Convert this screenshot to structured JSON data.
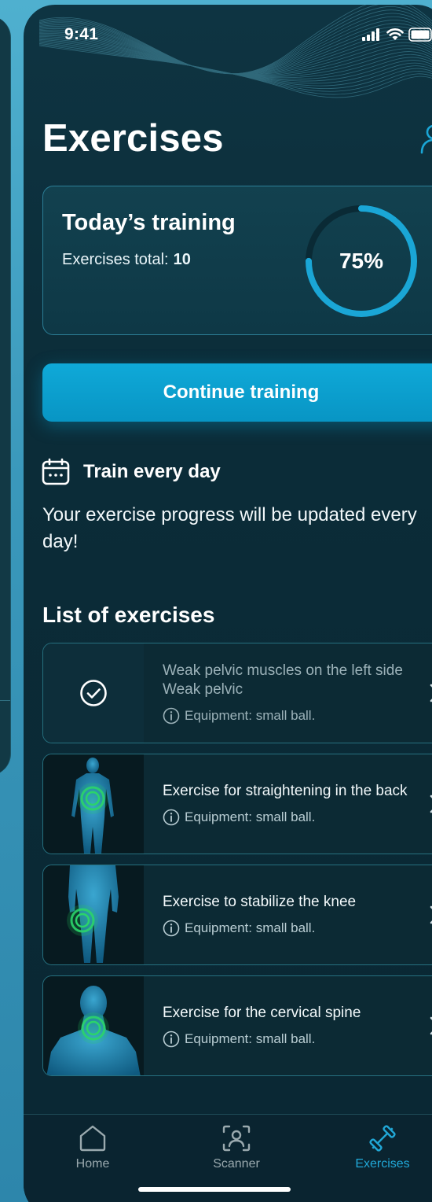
{
  "status_bar": {
    "time": "9:41"
  },
  "page": {
    "title": "Exercises"
  },
  "today": {
    "title": "Today’s training",
    "total_label": "Exercises total:",
    "total_value": "10",
    "progress_label": "75%",
    "progress": 0.75
  },
  "cta": {
    "label": "Continue training"
  },
  "reminder": {
    "title": "Train every day",
    "text": "Your exercise progress will be updated every day!"
  },
  "list": {
    "title": "List of exercises",
    "items": [
      {
        "name": "Weak pelvic muscles on the left side Weak pelvic",
        "equipment": "Equipment: small ball.",
        "status": "completed"
      },
      {
        "name": "Exercise for straightening in the back",
        "equipment": "Equipment: small ball.",
        "status": "pending"
      },
      {
        "name": "Exercise to stabilize the knee",
        "equipment": "Equipment: small ball.",
        "status": "pending"
      },
      {
        "name": "Exercise for the cervical spine",
        "equipment": "Equipment: small ball.",
        "status": "pending"
      }
    ]
  },
  "tabbar": {
    "items": [
      {
        "label": "Home",
        "icon": "home-icon"
      },
      {
        "label": "Scanner",
        "icon": "scanner-icon"
      },
      {
        "label": "Exercises",
        "icon": "dumbbell-icon",
        "active": true
      }
    ]
  },
  "colors": {
    "accent": "#1aa6d6",
    "background": "#0b2c38",
    "highlight": "#2bd46a"
  }
}
